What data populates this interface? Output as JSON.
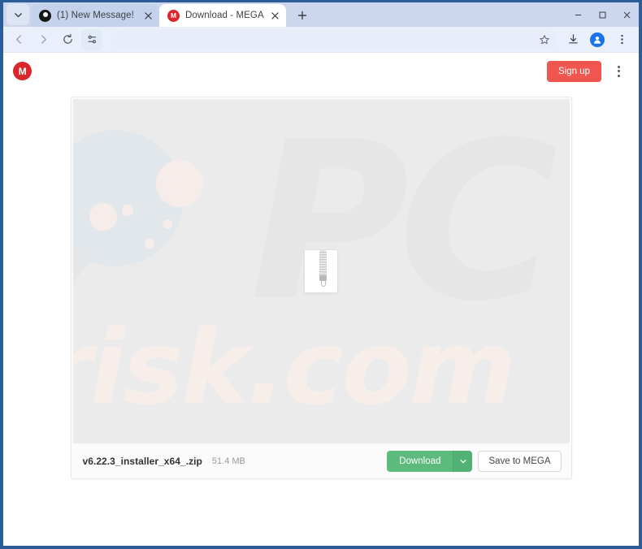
{
  "window": {
    "controls": {
      "minimize_label": "Minimize",
      "maximize_label": "Maximize",
      "close_label": "Close"
    }
  },
  "browser": {
    "tab_search_label": "Search tabs",
    "tabs": [
      {
        "title": "(1) New Message!",
        "favicon": "dark-circle-favicon",
        "active": false,
        "close_label": "Close tab"
      },
      {
        "title": "Download - MEGA",
        "favicon": "mega-favicon",
        "favicon_letter": "M",
        "active": true,
        "close_label": "Close tab"
      }
    ],
    "new_tab_label": "New Tab",
    "nav": {
      "back_label": "Back",
      "forward_label": "Forward",
      "reload_label": "Reload",
      "tab_options_label": "Tab options"
    },
    "omnibox": {
      "value": "",
      "placeholder": "",
      "bookmark_label": "Bookmark this tab"
    },
    "toolbar_right": {
      "downloads_label": "Downloads",
      "profile_label": "Profile",
      "menu_label": "Customize and control Google Chrome"
    }
  },
  "page": {
    "header": {
      "logo_letter": "M",
      "logo_name": "mega-logo",
      "signup_label": "Sign up",
      "menu_label": "Menu"
    },
    "preview": {
      "file_icon": "zip-file-icon",
      "watermarks": {
        "brand": "PC",
        "domain": "risk.com"
      }
    },
    "file": {
      "name": "v6.22.3_installer_x64_.zip",
      "size": "51.4 MB"
    },
    "actions": {
      "download_label": "Download",
      "download_caret_label": "Download options",
      "save_to_mega_label": "Save to MEGA"
    }
  },
  "colors": {
    "window_frame": "#2c5d99",
    "tabstrip": "#ccd7ef",
    "toolbar": "#eaf0fb",
    "mega_red": "#d9272e",
    "signup_red": "#f0554f",
    "download_green": "#5cba7d",
    "preview_bg": "#ebebeb"
  }
}
